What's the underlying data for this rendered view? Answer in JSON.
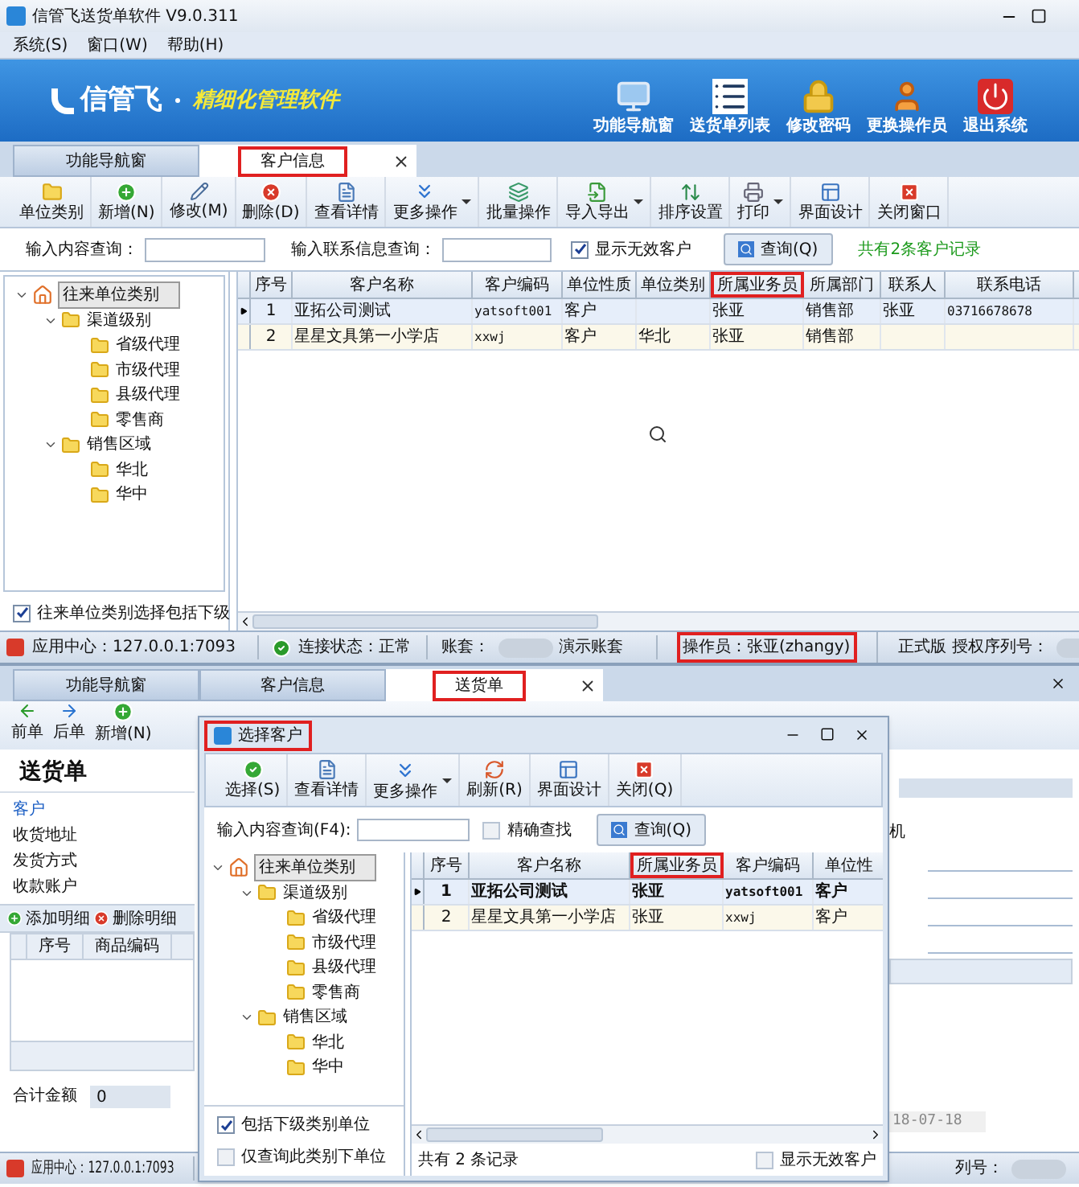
{
  "main": {
    "title": "信管飞送货单软件 V9.0.311",
    "menu": [
      "系统(S)",
      "窗口(W)",
      "帮助(H)"
    ],
    "brand": "信管飞",
    "tagline": "精细化管理软件",
    "nav_buttons": [
      "功能导航窗",
      "送货单列表",
      "修改密码",
      "更换操作员",
      "退出系统"
    ],
    "tabs": [
      {
        "label": "功能导航窗",
        "selected": false,
        "highlighted": false
      },
      {
        "label": "客户信息",
        "selected": true,
        "highlighted": true
      }
    ],
    "toolbar": [
      {
        "label": "单位类别",
        "dropdown": false
      },
      {
        "label": "新增(N)",
        "dropdown": false
      },
      {
        "label": "修改(M)",
        "dropdown": false
      },
      {
        "label": "删除(D)",
        "dropdown": false
      },
      {
        "label": "查看详情",
        "dropdown": false
      },
      {
        "label": "更多操作",
        "dropdown": true
      },
      {
        "label": "批量操作",
        "dropdown": false
      },
      {
        "label": "导入导出",
        "dropdown": true
      },
      {
        "label": "排序设置",
        "dropdown": false
      },
      {
        "label": "打印",
        "dropdown": true
      },
      {
        "label": "界面设计",
        "dropdown": false
      },
      {
        "label": "关闭窗口",
        "dropdown": false
      }
    ],
    "search": {
      "content_label": "输入内容查询：",
      "contact_label": "输入联系信息查询：",
      "show_invalid": {
        "label": "显示无效客户",
        "checked": true
      },
      "query_button": "查询(Q)",
      "record_count": "共有2条客户记录"
    },
    "tree": {
      "label": "往来单位类别",
      "selected": true,
      "expanded": true,
      "children": [
        {
          "label": "渠道级别",
          "selected": false,
          "expanded": true,
          "children": [
            {
              "label": "省级代理",
              "selected": false
            },
            {
              "label": "市级代理",
              "selected": false
            },
            {
              "label": "县级代理",
              "selected": false
            },
            {
              "label": "零售商",
              "selected": false
            }
          ]
        },
        {
          "label": "销售区域",
          "selected": false,
          "expanded": true,
          "children": [
            {
              "label": "华北",
              "selected": false
            },
            {
              "label": "华中",
              "selected": false
            }
          ]
        }
      ]
    },
    "include_sub": {
      "label": "往来单位类别选择包括下级",
      "checked": true
    },
    "table": {
      "columns": [
        {
          "label": "序号",
          "highlighted": false
        },
        {
          "label": "客户名称",
          "highlighted": false
        },
        {
          "label": "客户编码",
          "highlighted": false
        },
        {
          "label": "单位性质",
          "highlighted": false
        },
        {
          "label": "单位类别",
          "highlighted": false
        },
        {
          "label": "所属业务员",
          "highlighted": true
        },
        {
          "label": "所属部门",
          "highlighted": false
        },
        {
          "label": "联系人",
          "highlighted": false
        },
        {
          "label": "联系电话",
          "highlighted": false
        }
      ],
      "rows": [
        {
          "selected": true,
          "cells": [
            "1",
            "亚拓公司测试",
            "yatsoft001",
            "客户",
            "",
            "张亚",
            "销售部",
            "张亚",
            "03716678678"
          ]
        },
        {
          "selected": false,
          "cells": [
            "2",
            "星星文具第一小学店",
            "xxwj",
            "客户",
            "华北",
            "张亚",
            "销售部",
            "",
            ""
          ]
        }
      ]
    },
    "status_bar": [
      {
        "kind": "app",
        "text": "应用中心：127.0.0.1:7093",
        "highlighted": false
      },
      {
        "kind": "ok",
        "text": "连接状态：正常",
        "highlighted": false
      },
      {
        "kind": "account",
        "text": "账套：",
        "value": "演示账套",
        "highlighted": false
      },
      {
        "kind": "plain",
        "text": "操作员：张亚(zhangy)",
        "highlighted": true
      },
      {
        "kind": "serial",
        "text": "正式版 授权序列号：",
        "highlighted": false
      }
    ]
  },
  "second": {
    "tabs": [
      {
        "label": "功能导航窗",
        "selected": false,
        "highlighted": false
      },
      {
        "label": "客户信息",
        "selected": false,
        "highlighted": false
      },
      {
        "label": "送货单",
        "selected": true,
        "highlighted": true
      }
    ],
    "toolbar": [
      "前单",
      "后单",
      "新增(N)"
    ],
    "form_title": "送货单",
    "form_labels": [
      {
        "label": "客户",
        "required": true
      },
      {
        "label": "收货地址",
        "required": false
      },
      {
        "label": "发货方式",
        "required": false
      },
      {
        "label": "收款账户",
        "required": false
      }
    ],
    "right_label": "机",
    "detail_toolbar": [
      "添加明细",
      "删除明细"
    ],
    "detail_columns": [
      "序号",
      "商品编码"
    ],
    "total_label": "合计金额",
    "total_value": "0",
    "date": "18-07-18",
    "status_bar": [
      {
        "kind": "app",
        "text": "应用中心：127.0.0.1:7093",
        "highlighted": false
      },
      {
        "kind": "serial",
        "text": "列号：",
        "highlighted": false
      }
    ]
  },
  "dialog": {
    "title": "选择客户",
    "title_highlighted": true,
    "toolbar": [
      {
        "label": "选择(S)",
        "dropdown": false
      },
      {
        "label": "查看详情",
        "dropdown": false
      },
      {
        "label": "更多操作",
        "dropdown": true
      },
      {
        "label": "刷新(R)",
        "dropdown": false
      },
      {
        "label": "界面设计",
        "dropdown": false
      },
      {
        "label": "关闭(Q)",
        "dropdown": false
      }
    ],
    "search_label": "输入内容查询(F4):",
    "exact": {
      "label": "精确查找",
      "checked": false
    },
    "query_button": "查询(Q)",
    "tree": {
      "label": "往来单位类别",
      "selected": true,
      "expanded": true,
      "children": [
        {
          "label": "渠道级别",
          "selected": false,
          "expanded": true,
          "children": [
            {
              "label": "省级代理",
              "selected": false
            },
            {
              "label": "市级代理",
              "selected": false
            },
            {
              "label": "县级代理",
              "selected": false
            },
            {
              "label": "零售商",
              "selected": false
            }
          ]
        },
        {
          "label": "销售区域",
          "selected": false,
          "expanded": true,
          "children": [
            {
              "label": "华北",
              "selected": false
            },
            {
              "label": "华中",
              "selected": false
            }
          ]
        }
      ]
    },
    "include_sub": {
      "label": "包括下级类别单位",
      "checked": true
    },
    "only_this": {
      "label": "仅查询此类别下单位",
      "checked": false
    },
    "table": {
      "columns": [
        {
          "label": "序号",
          "highlighted": false
        },
        {
          "label": "客户名称",
          "highlighted": false
        },
        {
          "label": "所属业务员",
          "highlighted": true
        },
        {
          "label": "客户编码",
          "highlighted": false
        },
        {
          "label": "单位性",
          "highlighted": false
        }
      ],
      "rows": [
        {
          "selected": true,
          "cells": [
            "1",
            "亚拓公司测试",
            "张亚",
            "yatsoft001",
            "客户"
          ]
        },
        {
          "selected": false,
          "cells": [
            "2",
            "星星文具第一小学店",
            "张亚",
            "xxwj",
            "客户"
          ]
        }
      ]
    },
    "record_count": "共有 2 条记录",
    "show_invalid": {
      "label": "显示无效客户",
      "checked": false
    }
  }
}
